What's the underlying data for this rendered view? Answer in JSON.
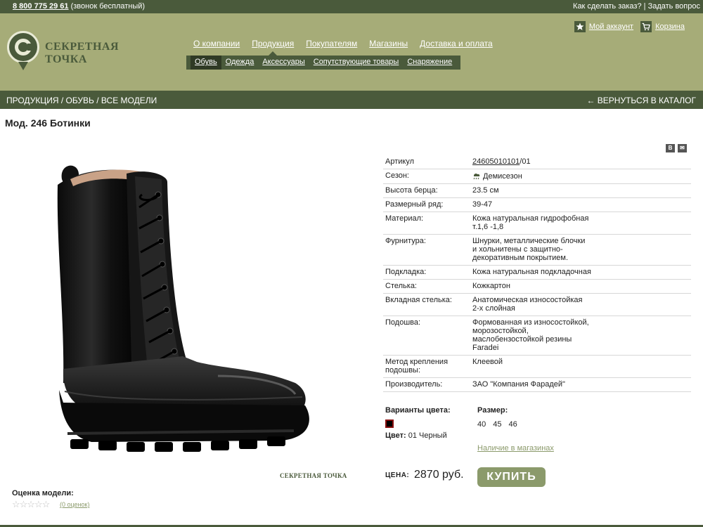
{
  "topbar": {
    "phone": "8 800 775 29 61",
    "phone_note": "(звонок бесплатный)",
    "how_to_order": "Как сделать заказ?",
    "separator": "|",
    "ask_question": "Задать вопрос"
  },
  "logo": {
    "text": "СЕКРЕТНАЯ ТОЧКА"
  },
  "account": {
    "my_account": "Мой аккаунт",
    "cart": "Корзина"
  },
  "mainnav": [
    "О компании",
    "Продукция",
    "Покупателям",
    "Магазины",
    "Доставка и оплата"
  ],
  "subnav": [
    "Обувь",
    "Одежда",
    "Аксессуары",
    "Сопутствующие товары",
    "Снаряжение"
  ],
  "breadcrumb": {
    "path": "ПРОДУКЦИЯ / ОБУВЬ / ВСЕ МОДЕЛИ",
    "back": "← ВЕРНУТЬСЯ В КАТАЛОГ"
  },
  "product": {
    "title": "Мод. 246 Ботинки",
    "watermark": "СЕКРЕТНАЯ ТОЧКА",
    "specs": [
      {
        "k": "Артикул",
        "v": "24605010101/01",
        "link": "24605010101"
      },
      {
        "k": "Сезон:",
        "v": "Демисезон",
        "icon": "season-icon"
      },
      {
        "k": "Высота берца:",
        "v": "23.5 см"
      },
      {
        "k": "Размерный ряд:",
        "v": "39-47"
      },
      {
        "k": "Материал:",
        "v": "Кожа натуральная гидрофобная\nт.1,6 -1,8"
      },
      {
        "k": "Фурнитура:",
        "v": "Шнурки, металлические блочки\nи хольнитены с защитно-\nдекоративным покрытием."
      },
      {
        "k": "Подкладка:",
        "v": "Кожа натуральная подкладочная"
      },
      {
        "k": "Стелька:",
        "v": "Кожкартон"
      },
      {
        "k": "Вкладная стелька:",
        "v": "Анатомическая износостойкая\n2-х слойная"
      },
      {
        "k": "Подошва:",
        "v": "Формованная из износостойкой,\nморозостойкой,\nмаслобензостойкой резины\nFaradei"
      },
      {
        "k": "Метод крепления\nподошвы:",
        "v": "Клеевой"
      },
      {
        "k": "Производитель:",
        "v": "ЗАО \"Компания Фарадей\""
      }
    ],
    "color_label": "Варианты цвета:",
    "color_prefix": "Цвет:",
    "color_name": "01 Черный",
    "size_label": "Размер:",
    "sizes": [
      "40",
      "45",
      "46"
    ],
    "availability": "Наличие в магазинах",
    "price_label": "ЦЕНА:",
    "price": "2870 руб.",
    "buy": "КУПИТЬ",
    "rating_label": "Оценка модели:",
    "stars": "☆☆☆☆☆",
    "reviews": "(0 оценок)"
  },
  "share": [
    "В",
    "✉"
  ],
  "colors": {
    "dark_green": "#4a5a3b",
    "olive": "#a6ac78",
    "button": "#8b9a6b"
  }
}
